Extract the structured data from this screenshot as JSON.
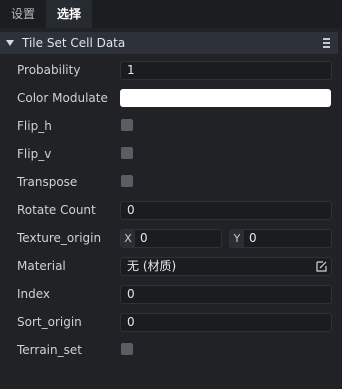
{
  "tabs": [
    {
      "label": "设置",
      "active": false
    },
    {
      "label": "选择",
      "active": true
    }
  ],
  "section": {
    "title": "Tile Set Cell Data",
    "icon": "menu-icon"
  },
  "properties": {
    "probability": {
      "label": "Probability",
      "value": "1"
    },
    "color_modulate": {
      "label": "Color Modulate",
      "color": "#ffffff"
    },
    "flip_h": {
      "label": "Flip_h",
      "checked": false
    },
    "flip_v": {
      "label": "Flip_v",
      "checked": false
    },
    "transpose": {
      "label": "Transpose",
      "checked": false
    },
    "rotate_count": {
      "label": "Rotate Count",
      "value": "0"
    },
    "texture_origin": {
      "label": "Texture_origin",
      "x_axis": "X",
      "x": "0",
      "y_axis": "Y",
      "y": "0"
    },
    "material": {
      "label": "Material",
      "value": "无 (材质)",
      "icon": "edit-resource-icon"
    },
    "index": {
      "label": "Index",
      "value": "0"
    },
    "sort_origin": {
      "label": "Sort_origin",
      "value": "0"
    },
    "terrain_set": {
      "label": "Terrain_set",
      "checked": false
    }
  }
}
